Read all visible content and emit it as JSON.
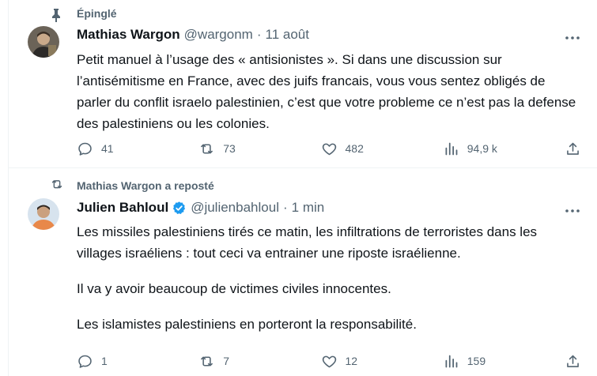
{
  "pinned_tweet": {
    "social_context": "Épinglé",
    "icon": "pin-icon",
    "author_name": "Mathias Wargon",
    "handle": "@wargonm",
    "separator": "·",
    "time": "11 août",
    "text": "Petit manuel à l’usage des « antisionistes ». Si dans une discussion sur l’antisémitisme en France, avec des juifs francais, vous vous sentez obligés de parler du conflit israelo palestinien, c’est que votre probleme ce n’est pas la defense des palestiniens ou les colonies.",
    "replies": "41",
    "retweets": "73",
    "likes": "482",
    "views": "94,9 k"
  },
  "repost_tweet": {
    "social_context": "Mathias Wargon a reposté",
    "icon": "repost-icon",
    "author_name": "Julien Bahloul",
    "verified": true,
    "handle": "@julienbahloul",
    "separator": "·",
    "time": "1 min",
    "paragraphs": [
      "Les missiles palestiniens tirés ce matin, les infiltrations de terroristes dans les villages israéliens : tout ceci va entrainer une riposte israélienne.",
      "Il va y avoir beaucoup de victimes civiles innocentes.",
      "Les islamistes palestiniens en porteront la responsabilité."
    ],
    "replies": "1",
    "retweets": "7",
    "likes": "12",
    "views": "159"
  },
  "colors": {
    "text": "#0f1419",
    "secondary": "#536471",
    "verified": "#1d9bf0",
    "divider": "#eff3f4"
  }
}
